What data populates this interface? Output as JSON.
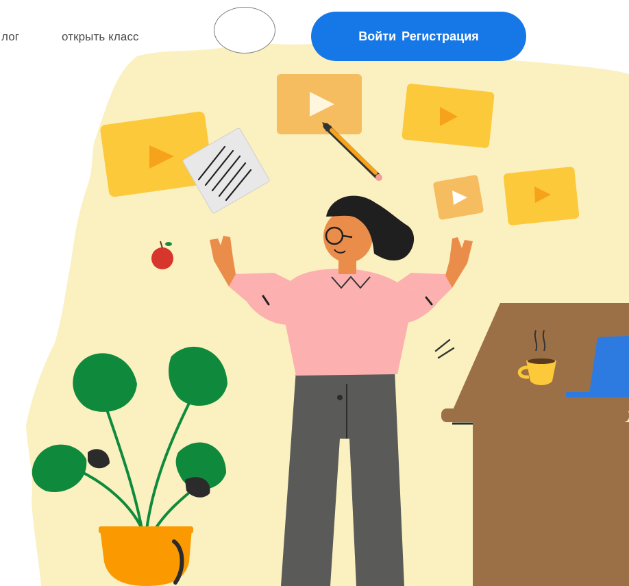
{
  "header": {
    "partial_link_label": "лог",
    "open_class_label": "открыть класс",
    "login_label": "Войти",
    "register_label": "Регистрация"
  },
  "colors": {
    "accent_blue": "#1677e6",
    "backdrop_cream": "#faf0c0",
    "video_yellow": "#fcc93a",
    "video_orange": "#f7a21b",
    "shirt_pink": "#fdb0b0",
    "pants_grey": "#5a5a58",
    "leaf_green": "#0f8a3c",
    "pot_orange": "#fb9a00",
    "desk_brown": "#9c7047",
    "laptop_blue": "#2d7be0"
  },
  "icons": [
    "play-icon",
    "pencil-icon",
    "apple-icon",
    "coffee-cup-icon",
    "laptop-icon"
  ]
}
